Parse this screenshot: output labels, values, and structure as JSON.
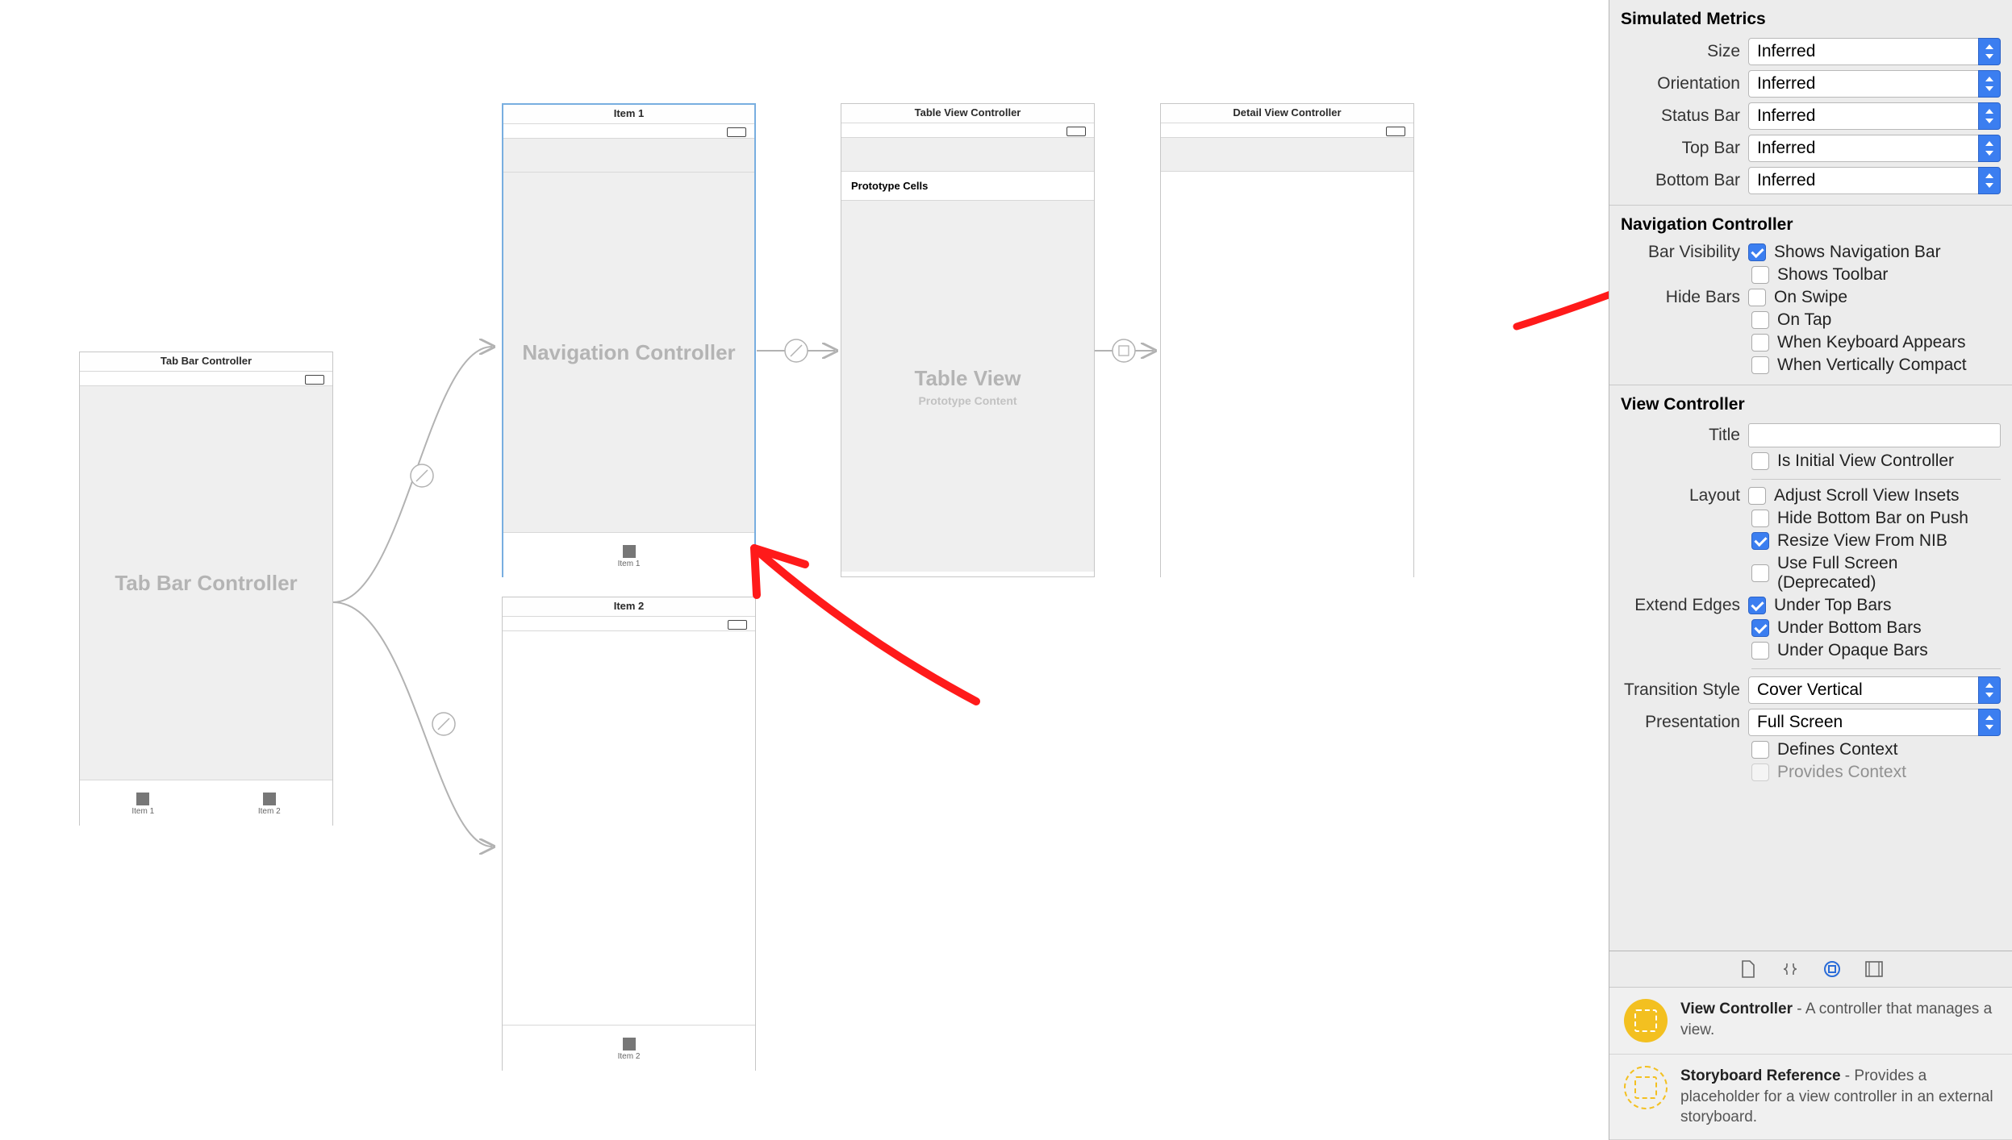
{
  "scenes": {
    "tabbar": {
      "title": "Tab Bar Controller",
      "body": "Tab Bar Controller",
      "items": [
        "Item 1",
        "Item 2"
      ]
    },
    "nav1": {
      "title": "Item 1",
      "body": "Navigation Controller",
      "item": "Item 1"
    },
    "nav2": {
      "title": "Item 2",
      "item": "Item 2"
    },
    "table": {
      "title": "Table View Controller",
      "proto": "Prototype Cells",
      "body": "Table View",
      "sub": "Prototype Content"
    },
    "detail": {
      "title": "Detail View Controller"
    }
  },
  "inspector": {
    "simulated": {
      "title": "Simulated Metrics",
      "size": {
        "label": "Size",
        "value": "Inferred"
      },
      "orientation": {
        "label": "Orientation",
        "value": "Inferred"
      },
      "statusbar": {
        "label": "Status Bar",
        "value": "Inferred"
      },
      "topbar": {
        "label": "Top Bar",
        "value": "Inferred"
      },
      "bottombar": {
        "label": "Bottom Bar",
        "value": "Inferred"
      }
    },
    "navcontroller": {
      "title": "Navigation Controller",
      "barvis": {
        "label": "Bar Visibility",
        "shows_nav": "Shows Navigation Bar",
        "shows_toolbar": "Shows Toolbar"
      },
      "hidebars": {
        "label": "Hide Bars",
        "onswipe": "On Swipe",
        "ontap": "On Tap",
        "keyboard": "When Keyboard Appears",
        "compact": "When Vertically Compact"
      }
    },
    "viewcontroller": {
      "title": "View Controller",
      "title_field": {
        "label": "Title"
      },
      "initial": "Is Initial View Controller",
      "layout": {
        "label": "Layout",
        "adjust": "Adjust Scroll View Insets",
        "hidebottom": "Hide Bottom Bar on Push",
        "resize": "Resize View From NIB",
        "fullscreen": "Use Full Screen (Deprecated)"
      },
      "extend": {
        "label": "Extend Edges",
        "top": "Under Top Bars",
        "bottom": "Under Bottom Bars",
        "opaque": "Under Opaque Bars"
      },
      "transition": {
        "label": "Transition Style",
        "value": "Cover Vertical"
      },
      "presentation": {
        "label": "Presentation",
        "value": "Full Screen"
      },
      "defines": "Defines Context",
      "provides": "Provides Context"
    }
  },
  "library": {
    "vc": {
      "name": "View Controller",
      "desc": " - A controller that manages a view."
    },
    "sb": {
      "name": "Storyboard Reference",
      "desc": " - Provides a placeholder for a view controller in an external storyboard."
    }
  }
}
